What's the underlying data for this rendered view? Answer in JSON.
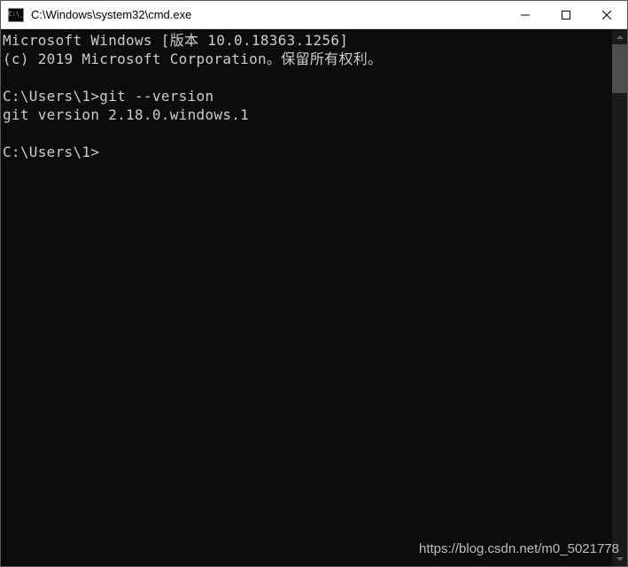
{
  "window": {
    "title": "C:\\Windows\\system32\\cmd.exe"
  },
  "terminal": {
    "lines": [
      "Microsoft Windows [版本 10.0.18363.1256]",
      "(c) 2019 Microsoft Corporation。保留所有权利。",
      "",
      "C:\\Users\\1>git --version",
      "git version 2.18.0.windows.1",
      "",
      "C:\\Users\\1>"
    ]
  },
  "watermark": "https://blog.csdn.net/m0_5021778"
}
